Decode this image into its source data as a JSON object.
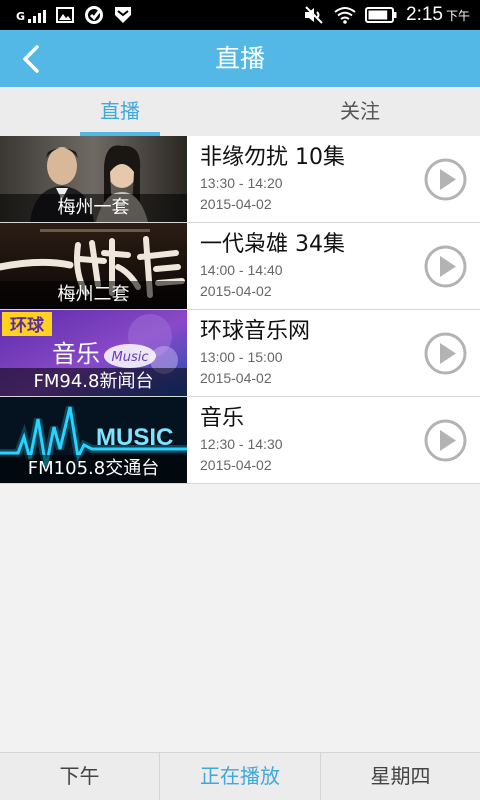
{
  "status_bar": {
    "carrier_glyph": "G",
    "time": "2:15",
    "ampm": "下午",
    "icons": [
      "signal-icon",
      "image-icon",
      "sync-icon",
      "shield-icon",
      "mute-icon",
      "wifi-icon",
      "battery-icon"
    ],
    "battery_level": 0.85
  },
  "header": {
    "title": "直播",
    "back_icon": "chevron-left-icon",
    "background": "#53b8e6"
  },
  "tabs": [
    {
      "label": "直播",
      "active": true
    },
    {
      "label": "关注",
      "active": false
    }
  ],
  "channels": [
    {
      "channel": "梅州一套",
      "title": "非缘勿扰 10集",
      "time": "13:30 - 14:20",
      "date": "2015-04-02"
    },
    {
      "channel": "梅州二套",
      "title": "一代枭雄 34集",
      "time": "14:00 - 14:40",
      "date": "2015-04-02"
    },
    {
      "channel": "FM94.8新闻台",
      "title": "环球音乐网",
      "time": "13:00 - 15:00",
      "date": "2015-04-02"
    },
    {
      "channel": "FM105.8交通台",
      "title": "音乐",
      "time": "12:30 - 14:30",
      "date": "2015-04-02"
    }
  ],
  "thumb_art": {
    "row3_logo": "环球",
    "row3_text": "音乐",
    "row3_badge": "Music",
    "row4_text": "MUSIC"
  },
  "bottom_bar": [
    {
      "label": "下午",
      "active": false
    },
    {
      "label": "正在播放",
      "active": true
    },
    {
      "label": "星期四",
      "active": false
    }
  ],
  "colors": {
    "accent": "#3fa9dc",
    "header": "#53b8e6"
  }
}
